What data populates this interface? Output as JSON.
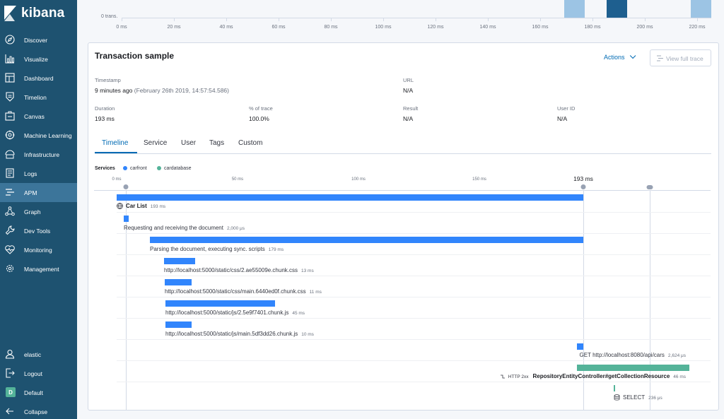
{
  "sidebar": {
    "brand": "kibana",
    "items": [
      {
        "label": "Discover",
        "icon": "compass-icon"
      },
      {
        "label": "Visualize",
        "icon": "chart-icon"
      },
      {
        "label": "Dashboard",
        "icon": "dashboard-icon"
      },
      {
        "label": "Timelion",
        "icon": "shield-icon"
      },
      {
        "label": "Canvas",
        "icon": "canvas-icon"
      },
      {
        "label": "Machine Learning",
        "icon": "ml-icon"
      },
      {
        "label": "Infrastructure",
        "icon": "infrastructure-icon"
      },
      {
        "label": "Logs",
        "icon": "logs-icon"
      },
      {
        "label": "APM",
        "icon": "apm-icon"
      },
      {
        "label": "Graph",
        "icon": "graph-icon"
      },
      {
        "label": "Dev Tools",
        "icon": "wrench-icon"
      },
      {
        "label": "Monitoring",
        "icon": "heartbeat-icon"
      },
      {
        "label": "Management",
        "icon": "gear-icon"
      }
    ],
    "bottom": [
      {
        "label": "elastic",
        "icon": "user-icon"
      },
      {
        "label": "Logout",
        "icon": "logout-icon"
      },
      {
        "label": "Default",
        "avatar": "D"
      },
      {
        "label": "Collapse",
        "icon": "arrow-left-icon"
      }
    ]
  },
  "top_chart": {
    "y_label": "0 trans.",
    "ticks": [
      "0 ms",
      "20 ms",
      "40 ms",
      "60 ms",
      "80 ms",
      "100 ms",
      "120 ms",
      "140 ms",
      "160 ms",
      "180 ms",
      "200 ms",
      "220 ms"
    ]
  },
  "panel": {
    "title": "Transaction sample",
    "actions_label": "Actions",
    "view_full_trace_label": "View full trace",
    "timestamp": {
      "label": "Timestamp",
      "relative": "9 minutes ago",
      "absolute": "(February 26th 2019, 14:57:54.586)"
    },
    "url": {
      "label": "URL",
      "value": "N/A"
    },
    "duration": {
      "label": "Duration",
      "value": "193 ms"
    },
    "percent_of_trace": {
      "label": "% of trace",
      "value": "100.0%"
    },
    "result": {
      "label": "Result",
      "value": "N/A"
    },
    "user_id": {
      "label": "User ID",
      "value": "N/A"
    },
    "tabs": [
      "Timeline",
      "Service",
      "User",
      "Tags",
      "Custom"
    ],
    "active_tab": "Timeline",
    "services_label": "Services",
    "services": [
      {
        "name": "carfront",
        "color": "#3185fc"
      },
      {
        "name": "cardatabase",
        "color": "#54b399"
      }
    ]
  },
  "timeline": {
    "ticks": [
      "0 ms",
      "50 ms",
      "100 ms",
      "150 ms"
    ],
    "total": "193 ms",
    "spans": [
      {
        "name": "Car List",
        "duration": "193 ms",
        "service": "carfront",
        "kind": "transaction"
      },
      {
        "name": "Requesting and receiving the document",
        "duration": "2,000 μs",
        "service": "carfront"
      },
      {
        "name": "Parsing the document, executing sync. scripts",
        "duration": "179 ms",
        "service": "carfront"
      },
      {
        "name": "http://localhost:5000/static/css/2.ae55009e.chunk.css",
        "duration": "13 ms",
        "service": "carfront"
      },
      {
        "name": "http://localhost:5000/static/css/main.6440ed0f.chunk.css",
        "duration": "11 ms",
        "service": "carfront"
      },
      {
        "name": "http://localhost:5000/static/js/2.5e9f7401.chunk.js",
        "duration": "45 ms",
        "service": "carfront"
      },
      {
        "name": "http://localhost:5000/static/js/main.5df3dd26.chunk.js",
        "duration": "10 ms",
        "service": "carfront"
      },
      {
        "name": "GET http://localhost:8080/api/cars",
        "duration": "2,624 μs",
        "service": "carfront"
      },
      {
        "name": "RepositoryEntityController#getCollectionResource",
        "duration": "46 ms",
        "service": "cardatabase",
        "status": "HTTP 2xx",
        "kind": "transaction"
      },
      {
        "name": "SELECT",
        "duration": "236 μs",
        "service": "cardatabase",
        "kind": "db"
      }
    ]
  }
}
